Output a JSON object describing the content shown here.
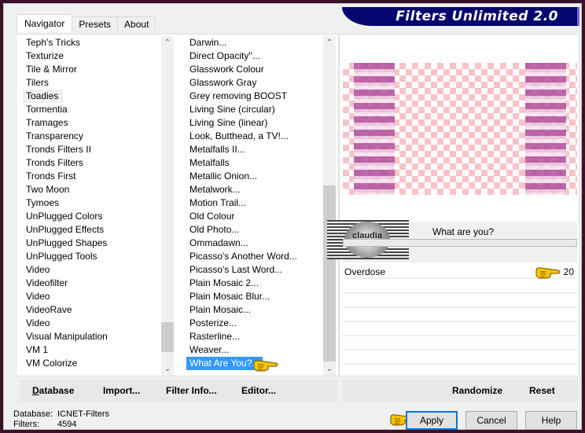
{
  "app": {
    "title": "Filters Unlimited 2.0"
  },
  "tabs": [
    {
      "label": "Navigator",
      "active": true
    },
    {
      "label": "Presets",
      "active": false
    },
    {
      "label": "About",
      "active": false
    }
  ],
  "categories": {
    "items": [
      "Teph's Tricks",
      "Texturize",
      "Tile & Mirror",
      "Tilers",
      "Toadies",
      "Tormentia",
      "Tramages",
      "Transparency",
      "Tronds Filters II",
      "Tronds Filters",
      "Tronds First",
      "Two Moon",
      "Tymoes",
      "UnPlugged Colors",
      "UnPlugged Effects",
      "UnPlugged Shapes",
      "UnPlugged Tools",
      "Video",
      "Videofilter",
      "Video",
      "VideoRave",
      "Video",
      "Visual Manipulation",
      "VM 1",
      "VM Colorize"
    ],
    "selected": "Toadies"
  },
  "filters": {
    "items": [
      "Darwin...",
      "Direct Opacity''...",
      "Glasswork Colour",
      "Glasswork Gray",
      "Grey removing BOOST",
      "Living Sine (circular)",
      "Living Sine (linear)",
      "Look, Butthead, a TV!...",
      "Metalfalls II...",
      "Metalfalls",
      "Metallic Onion...",
      "Metalwork...",
      "Motion Trail...",
      "Old Colour",
      "Old Photo...",
      "Ommadawn...",
      "Picasso's Another Word...",
      "Picasso's Last Word...",
      "Plain Mosaic 2...",
      "Plain Mosaic Blur...",
      "Plain Mosaic...",
      "Posterize...",
      "Rasterline...",
      "Weaver...",
      "What Are You?..."
    ],
    "selected": "What Are You?..."
  },
  "left_buttons": {
    "database": "Database",
    "import": "Import...",
    "filter_info": "Filter Info...",
    "editor": "Editor..."
  },
  "preview": {
    "filter_title": "What are you?",
    "logo_text": "claudia",
    "params": [
      {
        "label": "Overdose",
        "value": "20"
      }
    ]
  },
  "right_buttons": {
    "randomize": "Randomize",
    "reset": "Reset"
  },
  "status": {
    "database_label": "Database:",
    "database_value": "ICNET-Filters",
    "filters_label": "Filters:",
    "filters_value": "4594"
  },
  "dialog_buttons": {
    "apply": "Apply",
    "cancel": "Cancel",
    "help": "Help"
  },
  "colors": {
    "banner": "#05056e",
    "selection": "#3399ff",
    "apply_focus": "#0078d7"
  }
}
